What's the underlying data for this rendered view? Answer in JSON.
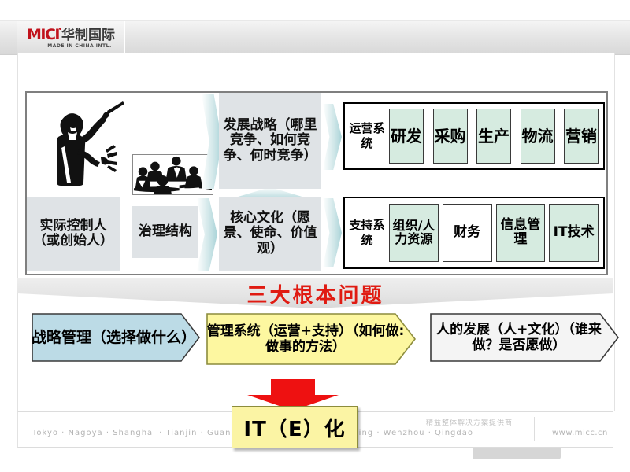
{
  "header": {
    "logo_mark": "MICI",
    "logo_cn": "华制国际",
    "logo_tagline": "MADE IN CHINA INTL."
  },
  "diagram": {
    "images": [
      {
        "name": "conductor-clipart",
        "alt": "指挥家"
      },
      {
        "name": "meeting-clipart",
        "alt": "会议"
      }
    ],
    "boxes": {
      "actual_controller": "实际控制人（或创始人）",
      "governance": "治理结构",
      "development_strategy": "发展战略（哪里竞争、如何竞争、何时竞争）",
      "core_culture": "核心文化（愿景、使命、价值观）"
    },
    "operations_system": {
      "title": "运营系统",
      "cells": [
        "研发",
        "采购",
        "生产",
        "物流",
        "营销"
      ]
    },
    "support_system": {
      "title": "支持系统",
      "cells": [
        "组织/人力资源",
        "财务",
        "信息管理",
        "IT技术"
      ]
    }
  },
  "banner": {
    "text": "三大根本问题",
    "color": "#e01b12"
  },
  "pentagons": [
    {
      "id": "strategy",
      "text": "战略管理（选择做什么）",
      "fill": "#bcdbe6",
      "stroke": "#3a3a3a"
    },
    {
      "id": "management",
      "text": "管理系统（运营+支持）（如何做:做事的方法）",
      "fill": "#fdf7a0",
      "stroke": "#8c8c3c"
    },
    {
      "id": "people",
      "text": "人的发展（人+文化）（谁来做？是否愿做）",
      "fill": "#f4f4f4",
      "stroke": "#3a3a3a"
    }
  ],
  "arrow": {
    "name": "down-arrow",
    "color": "#ee1111"
  },
  "it_box": {
    "text": "IT（E）化",
    "fill": "#fbf4a4"
  },
  "footer": {
    "cities": "Tokyo · Nagoya · Shanghai · Tianjin · Guangzhou · Shenzhen · Chongqing · Wenzhou · Qingdao",
    "slogan": "精益整体解决方案提供商",
    "url": "www.micc.cn"
  },
  "colors": {
    "cell_green": "#d6ebe0",
    "box_grey": "#dfe3e6",
    "chevron_teal": "#a9d3d8",
    "banner_red": "#e01b12",
    "brand_red": "#c1121c"
  }
}
